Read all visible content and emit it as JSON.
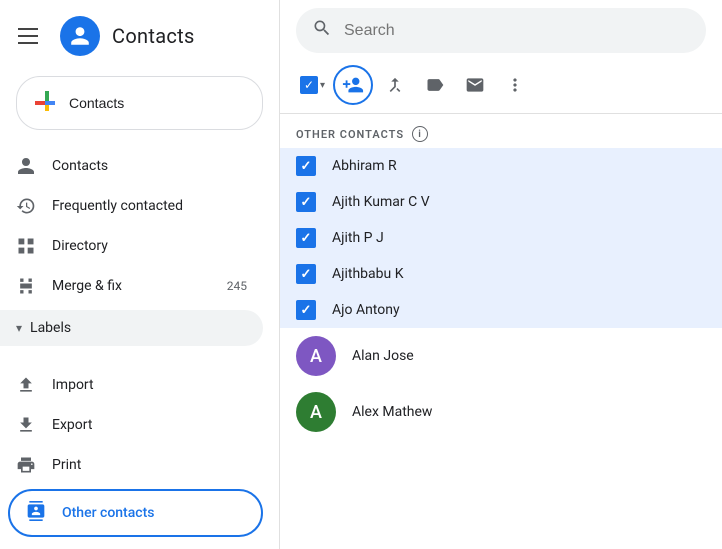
{
  "app": {
    "title": "Contacts"
  },
  "search": {
    "placeholder": "Search"
  },
  "sidebar": {
    "nav_items": [
      {
        "id": "contacts",
        "label": "Contacts",
        "icon": "person"
      },
      {
        "id": "frequently-contacted",
        "label": "Frequently contacted",
        "icon": "history"
      },
      {
        "id": "directory",
        "label": "Directory",
        "icon": "grid"
      },
      {
        "id": "merge-fix",
        "label": "Merge & fix",
        "icon": "merge",
        "badge": "245"
      }
    ],
    "labels": {
      "label": "Labels"
    },
    "footer_items": [
      {
        "id": "import",
        "label": "Import",
        "icon": "upload"
      },
      {
        "id": "export",
        "label": "Export",
        "icon": "download"
      },
      {
        "id": "print",
        "label": "Print",
        "icon": "print"
      },
      {
        "id": "other-contacts",
        "label": "Other contacts",
        "icon": "contacts-book",
        "active": true
      }
    ]
  },
  "toolbar": {
    "checkbox_label": "Select",
    "add_contact_label": "Save contact",
    "merge_label": "Merge",
    "label_label": "Label",
    "email_label": "Send email",
    "more_label": "More"
  },
  "section": {
    "title": "OTHER CONTACTS"
  },
  "contacts": [
    {
      "id": 1,
      "name": "Abhiram R",
      "checked": true,
      "has_avatar": false,
      "avatar_color": ""
    },
    {
      "id": 2,
      "name": "Ajith Kumar C V",
      "checked": true,
      "has_avatar": false,
      "avatar_color": ""
    },
    {
      "id": 3,
      "name": "Ajith P J",
      "checked": true,
      "has_avatar": false,
      "avatar_color": ""
    },
    {
      "id": 4,
      "name": "Ajithbabu K",
      "checked": true,
      "has_avatar": false,
      "avatar_color": ""
    },
    {
      "id": 5,
      "name": "Ajo Antony",
      "checked": true,
      "has_avatar": false,
      "avatar_color": ""
    },
    {
      "id": 6,
      "name": "Alan Jose",
      "checked": false,
      "has_avatar": true,
      "avatar_color": "#7e57c2",
      "avatar_letter": "A"
    },
    {
      "id": 7,
      "name": "Alex Mathew",
      "checked": false,
      "has_avatar": true,
      "avatar_color": "#2e7d32",
      "avatar_letter": "A"
    }
  ]
}
